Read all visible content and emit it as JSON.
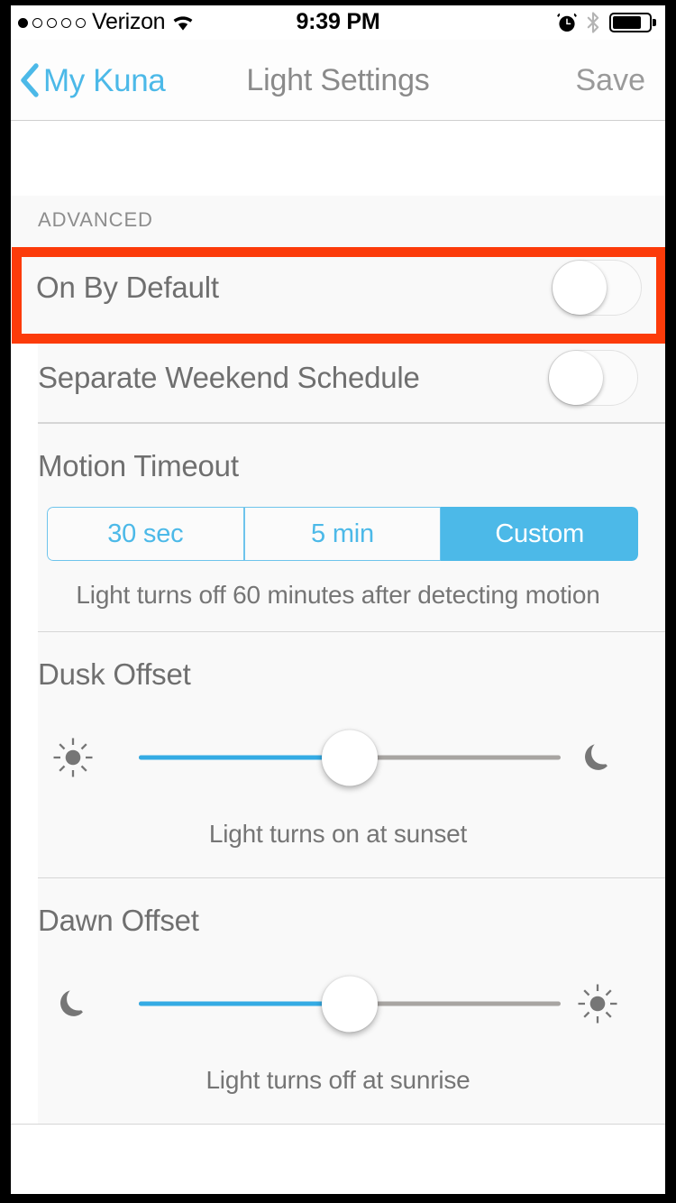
{
  "status_bar": {
    "signal_dots_total": 5,
    "signal_dots_filled": 1,
    "carrier": "Verizon",
    "wifi_icon": "wifi-icon",
    "time": "9:39 PM",
    "alarm_icon": "alarm-clock-icon",
    "bluetooth_icon": "bluetooth-icon",
    "battery_icon": "battery-icon",
    "battery_level_percent": 82
  },
  "nav_bar": {
    "back_icon": "chevron-left-icon",
    "back_label": "My Kuna",
    "title": "Light Settings",
    "save_label": "Save"
  },
  "section": {
    "header": "ADVANCED"
  },
  "rows": {
    "on_by_default": {
      "label": "On By Default",
      "switch_state": "off",
      "highlighted": true
    },
    "separate_weekend_schedule": {
      "label": "Separate Weekend Schedule",
      "switch_state": "off"
    }
  },
  "motion_timeout": {
    "title": "Motion Timeout",
    "options": [
      "30 sec",
      "5 min",
      "Custom"
    ],
    "selected": "Custom",
    "hint": "Light turns off 60 minutes after detecting motion"
  },
  "dusk_offset": {
    "title": "Dusk Offset",
    "left_icon": "sun-icon",
    "right_icon": "moon-icon",
    "value_percent": 50,
    "caption": "Light turns on at sunset"
  },
  "dawn_offset": {
    "title": "Dawn Offset",
    "left_icon": "moon-icon",
    "right_icon": "sun-icon",
    "value_percent": 50,
    "caption": "Light turns off at sunrise"
  },
  "colors": {
    "accent_blue": "#4cb9e8",
    "slider_fill_blue": "#34abe4",
    "highlight_red": "#fc3b0a",
    "text_gray": "#6f6f6f",
    "muted_gray": "#8d8d8d",
    "row_background": "#f9f9f9"
  }
}
